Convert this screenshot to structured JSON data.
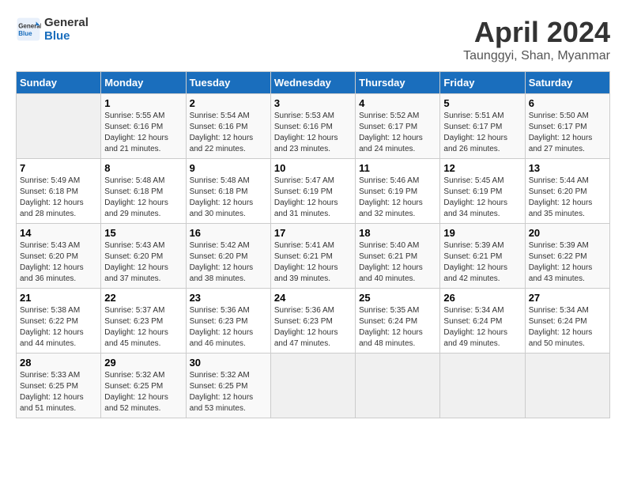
{
  "logo": {
    "line1": "General",
    "line2": "Blue"
  },
  "title": "April 2024",
  "subtitle": "Taunggyi, Shan, Myanmar",
  "days_header": [
    "Sunday",
    "Monday",
    "Tuesday",
    "Wednesday",
    "Thursday",
    "Friday",
    "Saturday"
  ],
  "weeks": [
    [
      {
        "day": "",
        "info": ""
      },
      {
        "day": "1",
        "info": "Sunrise: 5:55 AM\nSunset: 6:16 PM\nDaylight: 12 hours\nand 21 minutes."
      },
      {
        "day": "2",
        "info": "Sunrise: 5:54 AM\nSunset: 6:16 PM\nDaylight: 12 hours\nand 22 minutes."
      },
      {
        "day": "3",
        "info": "Sunrise: 5:53 AM\nSunset: 6:16 PM\nDaylight: 12 hours\nand 23 minutes."
      },
      {
        "day": "4",
        "info": "Sunrise: 5:52 AM\nSunset: 6:17 PM\nDaylight: 12 hours\nand 24 minutes."
      },
      {
        "day": "5",
        "info": "Sunrise: 5:51 AM\nSunset: 6:17 PM\nDaylight: 12 hours\nand 26 minutes."
      },
      {
        "day": "6",
        "info": "Sunrise: 5:50 AM\nSunset: 6:17 PM\nDaylight: 12 hours\nand 27 minutes."
      }
    ],
    [
      {
        "day": "7",
        "info": "Sunrise: 5:49 AM\nSunset: 6:18 PM\nDaylight: 12 hours\nand 28 minutes."
      },
      {
        "day": "8",
        "info": "Sunrise: 5:48 AM\nSunset: 6:18 PM\nDaylight: 12 hours\nand 29 minutes."
      },
      {
        "day": "9",
        "info": "Sunrise: 5:48 AM\nSunset: 6:18 PM\nDaylight: 12 hours\nand 30 minutes."
      },
      {
        "day": "10",
        "info": "Sunrise: 5:47 AM\nSunset: 6:19 PM\nDaylight: 12 hours\nand 31 minutes."
      },
      {
        "day": "11",
        "info": "Sunrise: 5:46 AM\nSunset: 6:19 PM\nDaylight: 12 hours\nand 32 minutes."
      },
      {
        "day": "12",
        "info": "Sunrise: 5:45 AM\nSunset: 6:19 PM\nDaylight: 12 hours\nand 34 minutes."
      },
      {
        "day": "13",
        "info": "Sunrise: 5:44 AM\nSunset: 6:20 PM\nDaylight: 12 hours\nand 35 minutes."
      }
    ],
    [
      {
        "day": "14",
        "info": "Sunrise: 5:43 AM\nSunset: 6:20 PM\nDaylight: 12 hours\nand 36 minutes."
      },
      {
        "day": "15",
        "info": "Sunrise: 5:43 AM\nSunset: 6:20 PM\nDaylight: 12 hours\nand 37 minutes."
      },
      {
        "day": "16",
        "info": "Sunrise: 5:42 AM\nSunset: 6:20 PM\nDaylight: 12 hours\nand 38 minutes."
      },
      {
        "day": "17",
        "info": "Sunrise: 5:41 AM\nSunset: 6:21 PM\nDaylight: 12 hours\nand 39 minutes."
      },
      {
        "day": "18",
        "info": "Sunrise: 5:40 AM\nSunset: 6:21 PM\nDaylight: 12 hours\nand 40 minutes."
      },
      {
        "day": "19",
        "info": "Sunrise: 5:39 AM\nSunset: 6:21 PM\nDaylight: 12 hours\nand 42 minutes."
      },
      {
        "day": "20",
        "info": "Sunrise: 5:39 AM\nSunset: 6:22 PM\nDaylight: 12 hours\nand 43 minutes."
      }
    ],
    [
      {
        "day": "21",
        "info": "Sunrise: 5:38 AM\nSunset: 6:22 PM\nDaylight: 12 hours\nand 44 minutes."
      },
      {
        "day": "22",
        "info": "Sunrise: 5:37 AM\nSunset: 6:23 PM\nDaylight: 12 hours\nand 45 minutes."
      },
      {
        "day": "23",
        "info": "Sunrise: 5:36 AM\nSunset: 6:23 PM\nDaylight: 12 hours\nand 46 minutes."
      },
      {
        "day": "24",
        "info": "Sunrise: 5:36 AM\nSunset: 6:23 PM\nDaylight: 12 hours\nand 47 minutes."
      },
      {
        "day": "25",
        "info": "Sunrise: 5:35 AM\nSunset: 6:24 PM\nDaylight: 12 hours\nand 48 minutes."
      },
      {
        "day": "26",
        "info": "Sunrise: 5:34 AM\nSunset: 6:24 PM\nDaylight: 12 hours\nand 49 minutes."
      },
      {
        "day": "27",
        "info": "Sunrise: 5:34 AM\nSunset: 6:24 PM\nDaylight: 12 hours\nand 50 minutes."
      }
    ],
    [
      {
        "day": "28",
        "info": "Sunrise: 5:33 AM\nSunset: 6:25 PM\nDaylight: 12 hours\nand 51 minutes."
      },
      {
        "day": "29",
        "info": "Sunrise: 5:32 AM\nSunset: 6:25 PM\nDaylight: 12 hours\nand 52 minutes."
      },
      {
        "day": "30",
        "info": "Sunrise: 5:32 AM\nSunset: 6:25 PM\nDaylight: 12 hours\nand 53 minutes."
      },
      {
        "day": "",
        "info": ""
      },
      {
        "day": "",
        "info": ""
      },
      {
        "day": "",
        "info": ""
      },
      {
        "day": "",
        "info": ""
      }
    ]
  ]
}
